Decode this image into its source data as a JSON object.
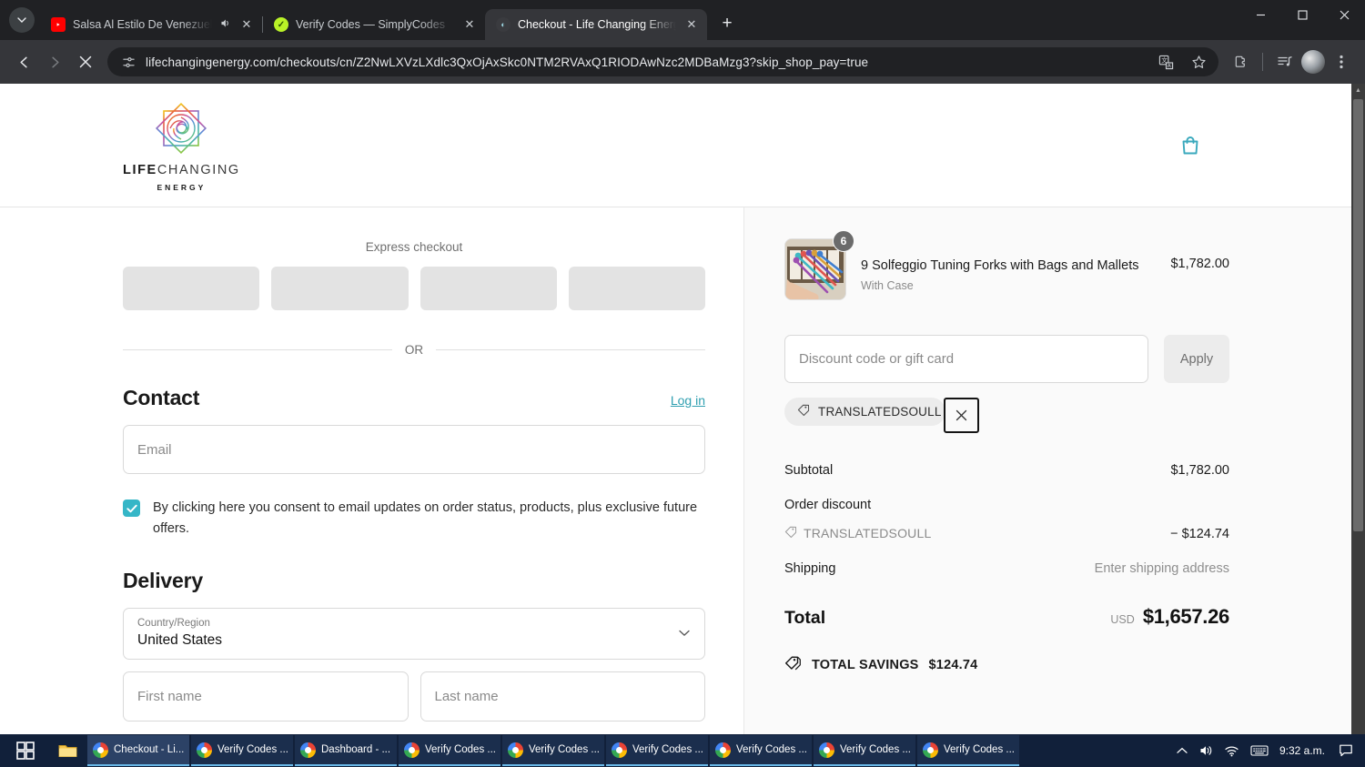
{
  "browser": {
    "tabs": [
      {
        "title": "Salsa Al Estilo De Venezuela",
        "favicon": "youtube-icon",
        "active": false,
        "muted_audio_icon": "speaker-icon"
      },
      {
        "title": "Verify Codes — SimplyCodes",
        "favicon": "simplycodes-icon",
        "active": false
      },
      {
        "title": "Checkout - Life Changing Energ",
        "favicon": "lifechanging-icon",
        "active": true
      }
    ],
    "new_tab_label": "+",
    "tab_search_icon": "chevron-down-icon",
    "nav": {
      "back_icon": "back-arrow-icon",
      "forward_icon": "forward-arrow-icon",
      "stop_icon": "stop-loading-icon"
    },
    "omnibox": {
      "site_info_icon": "page-settings-icon",
      "url": "lifechangingenergy.com/checkouts/cn/Z2NwLXVzLXdlc3QxOjAxSkc0NTM2RVAxQ1RIODAwNzc2MDBaMzg3?skip_shop_pay=true",
      "translate_icon": "translate-icon",
      "bookmark_icon": "star-icon"
    },
    "toolbar_icons": [
      "extensions-icon",
      "media-control-icon",
      "profile-avatar",
      "three-dot-menu-icon"
    ],
    "window_controls": {
      "minimize": "minimize-icon",
      "maximize": "maximize-icon",
      "close": "close-icon"
    }
  },
  "site": {
    "logo": {
      "line1_bold": "LIFE",
      "line1_thin": "CHANGING",
      "line2": "ENERGY",
      "mark": "rainbow-star-logo"
    },
    "cart_icon": "shopping-bag-icon"
  },
  "checkout": {
    "express": {
      "label": "Express checkout",
      "buttons": [
        "express-pay-1",
        "express-pay-2",
        "express-pay-3",
        "express-pay-4"
      ],
      "divider_text": "OR"
    },
    "contact": {
      "title": "Contact",
      "login_link": "Log in",
      "email_placeholder": "Email",
      "email_value": "",
      "consent_checked": true,
      "consent_text": "By clicking here you consent to email updates on order status, products, plus exclusive future offers."
    },
    "delivery": {
      "title": "Delivery",
      "country_label": "Country/Region",
      "country_value": "United States",
      "country_chevron": "chevron-down-icon",
      "first_name_placeholder": "First name",
      "first_name_value": "",
      "last_name_placeholder": "Last name",
      "last_name_value": ""
    }
  },
  "summary": {
    "product": {
      "quantity_badge": "6",
      "title": "9 Solfeggio Tuning Forks with Bags and Mallets",
      "variant": "With Case",
      "price": "$1,782.00",
      "image_alt": "tuning-forks-thumbnail"
    },
    "discount": {
      "placeholder": "Discount code or gift card",
      "value": "",
      "apply_label": "Apply",
      "applied_chip": "TRANSLATEDSOULL",
      "chip_remove_icon": "close-icon",
      "chip_tag_icon": "tag-icon"
    },
    "lines": [
      {
        "label": "Subtotal",
        "value": "$1,782.00",
        "muted": false
      },
      {
        "label": "Order discount",
        "value": "",
        "muted": false
      }
    ],
    "discount_line": {
      "code": "TRANSLATEDSOULL",
      "amount": "− $124.74",
      "tag_icon": "tag-icon"
    },
    "shipping": {
      "label": "Shipping",
      "value": "Enter shipping address"
    },
    "total": {
      "label": "Total",
      "currency": "USD",
      "amount": "$1,657.26"
    },
    "savings": {
      "icon": "savings-tag-icon",
      "label": "TOTAL SAVINGS",
      "amount": "$124.74"
    }
  },
  "colors": {
    "accent_teal": "#35b6c7",
    "link_teal": "#2f9fb0",
    "panel_bg": "#fafafa",
    "browser_chrome": "#202124",
    "taskbar": "#11203a"
  },
  "taskbar": {
    "start_icon": "windows-start-icon",
    "file_explorer_icon": "folder-icon",
    "items": [
      {
        "label": "Checkout - Li...",
        "icon": "chrome-icon",
        "active": true
      },
      {
        "label": "Verify Codes ...",
        "icon": "chrome-icon",
        "active": false
      },
      {
        "label": "Dashboard - ...",
        "icon": "chrome-icon",
        "active": false
      },
      {
        "label": "Verify Codes ...",
        "icon": "chrome-icon",
        "active": false
      },
      {
        "label": "Verify Codes ...",
        "icon": "chrome-icon",
        "active": false
      },
      {
        "label": "Verify Codes ...",
        "icon": "chrome-icon",
        "active": false
      },
      {
        "label": "Verify Codes ...",
        "icon": "chrome-icon",
        "active": false
      },
      {
        "label": "Verify Codes ...",
        "icon": "chrome-icon",
        "active": false
      },
      {
        "label": "Verify Codes ...",
        "icon": "chrome-icon",
        "active": false
      }
    ],
    "tray": {
      "overflow_icon": "chevron-up-icon",
      "volume_icon": "speaker-icon",
      "network_icon": "wifi-icon",
      "keyboard_icon": "keyboard-icon",
      "clock": "9:32 a.m.",
      "notifications_icon": "notification-icon"
    }
  }
}
